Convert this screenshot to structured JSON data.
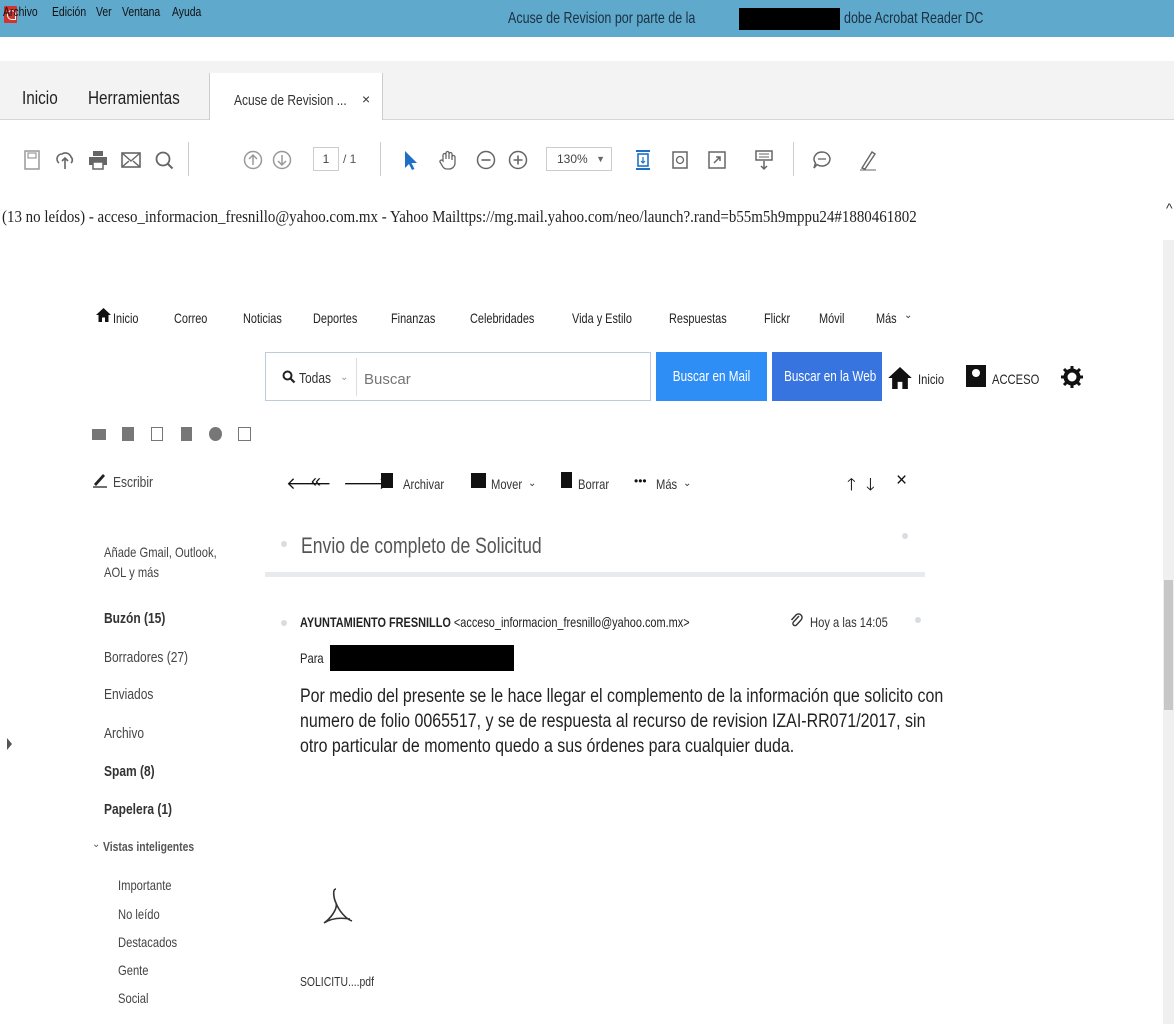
{
  "window": {
    "title_left": "Acuse de Revision por parte  de la",
    "title_right": "dobe Acrobat Reader DC"
  },
  "menu": [
    "Archivo",
    "Edición",
    "Ver",
    "Ventana",
    "Ayuda"
  ],
  "tabs": {
    "home": "Inicio",
    "tools": "Herramientas",
    "document": "Acuse de Revision ...",
    "close": "×"
  },
  "toolbar": {
    "page_current": "1",
    "page_total": "/ 1",
    "zoom": "130%"
  },
  "page_header": "(13 no leídos) - acceso_informacion_fresnillo@yahoo.com.mx - Yahoo Mailttps://mg.mail.yahoo.com/neo/launch?.rand=b55m5h9mppu24#1880461802",
  "yahoo_nav": [
    "Inicio",
    "Correo",
    "Noticias",
    "Deportes",
    "Finanzas",
    "Celebridades",
    "Vida y Estilo",
    "Respuestas",
    "Flickr",
    "Móvil",
    "Más"
  ],
  "search": {
    "scope": "Todas",
    "placeholder": "Buscar",
    "btn_mail": "Buscar en Mail",
    "btn_web": "Buscar en la Web",
    "home": "Inicio",
    "account": "ACCESO"
  },
  "sidebar": {
    "compose": "Escribir",
    "add_accounts": [
      "Añade Gmail, Outlook,",
      "AOL y más"
    ],
    "folders": [
      {
        "label": "Buzón (15)",
        "bold": true
      },
      {
        "label": "Borradores (27)",
        "bold": false
      },
      {
        "label": "Enviados",
        "bold": false
      },
      {
        "label": "Archivo",
        "bold": false
      },
      {
        "label": "Spam (8)",
        "bold": true
      },
      {
        "label": "Papelera (1)",
        "bold": true
      }
    ],
    "smart_views": "Vistas inteligentes",
    "smart_items": [
      "Importante",
      "No leído",
      "Destacados",
      "Gente",
      "Social"
    ]
  },
  "actions": {
    "archive": "Archivar",
    "move": "Mover",
    "delete": "Borrar",
    "more": "Más"
  },
  "message": {
    "subject": "Envio de completo de Solicitud",
    "sender_name": "AYUNTAMIENTO FRESNILLO",
    "sender_email": "<acceso_informacion_fresnillo@yahoo.com.mx>",
    "date": "Hoy a las 14:05",
    "to_label": "Para",
    "body": "Por medio del presente se le hace llegar el complemento de la información que solicito con numero de folio 0065517, y se de respuesta al recurso de revision IZAI-RR071/2017, sin otro particular de momento quedo a sus órdenes para cualquier duda.",
    "attachment": "SOLICITU....pdf"
  }
}
